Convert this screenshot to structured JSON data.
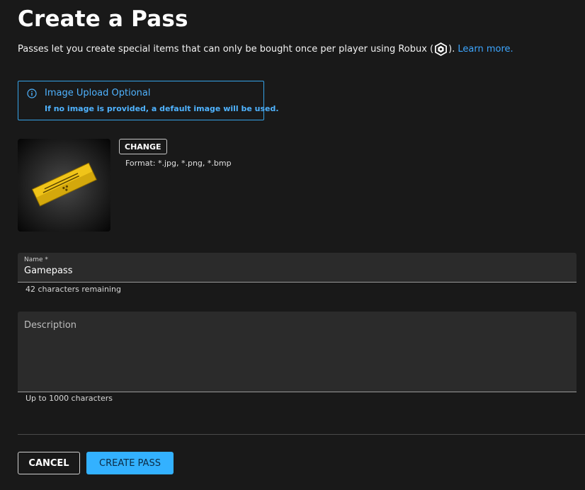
{
  "header": {
    "title": "Create a Pass",
    "subtitle_before": "Passes let you create special items that can only be bought once per player using Robux (",
    "subtitle_after": ").",
    "learn_more": "Learn more."
  },
  "icons": {
    "robux": "robux-icon",
    "info": "info-icon",
    "pass_image": "ticket-icon"
  },
  "alert": {
    "title": "Image Upload Optional",
    "text": "If no image is provided, a default image will be used.",
    "color": "#35a3e8"
  },
  "image": {
    "change_label": "CHANGE",
    "format_text": "Format: *.jpg, *.png, *.bmp"
  },
  "name_field": {
    "label": "Name *",
    "value": "Gamepass",
    "helper": "42 characters remaining"
  },
  "description_field": {
    "placeholder": "Description",
    "value": "",
    "helper": "Up to 1000 characters"
  },
  "actions": {
    "cancel_label": "CANCEL",
    "create_label": "CREATE PASS",
    "primary_color": "#33b1ff"
  }
}
